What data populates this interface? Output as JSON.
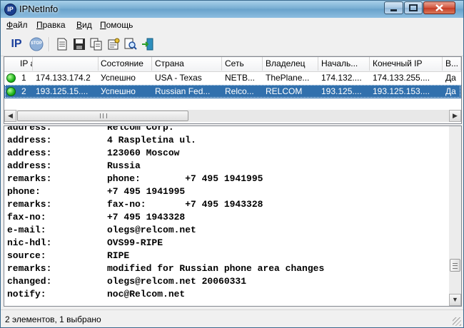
{
  "window": {
    "title": "IPNetInfo"
  },
  "menu": [
    {
      "label": "Файл",
      "accel": "Ф",
      "rest": "айл"
    },
    {
      "label": "Правка",
      "accel": "П",
      "rest": "равка"
    },
    {
      "label": "Вид",
      "accel": "В",
      "rest": "ид"
    },
    {
      "label": "Помощь",
      "accel": "П",
      "rest": "омощь"
    }
  ],
  "toolbar": {
    "ip_label": "IP",
    "stop_label": "STOP",
    "icons": [
      "ip-icon",
      "stop-icon",
      "document-icon",
      "save-icon",
      "copy-icon",
      "properties-icon",
      "find-icon",
      "exit-icon"
    ]
  },
  "list": {
    "columns": [
      "IP адрес",
      "Состояние",
      "Страна",
      "Сеть",
      "Владелец",
      "Началь...",
      "Конечный IP",
      "В..."
    ],
    "rows": [
      {
        "index": "1",
        "ip": "174.133.174.2",
        "status": "Успешно",
        "country": "USA - Texas",
        "network": "NETB...",
        "owner": "ThePlane...",
        "start": "174.132....",
        "end": "174.133.255....",
        "v": "Да",
        "selected": false
      },
      {
        "index": "2",
        "ip": "193.125.15....",
        "status": "Успешно",
        "country": "Russian Fed...",
        "network": "Relco...",
        "owner": "RELCOM",
        "start": "193.125....",
        "end": "193.125.153....",
        "v": "Да",
        "selected": true
      }
    ]
  },
  "whois": [
    {
      "key": "address:",
      "value": "Relcom Corp."
    },
    {
      "key": "address:",
      "value": "4 Raspletina ul."
    },
    {
      "key": "address:",
      "value": "123060 Moscow"
    },
    {
      "key": "address:",
      "value": "Russia"
    },
    {
      "key": "remarks:",
      "value": "phone:        +7 495 1941995"
    },
    {
      "key": "phone:",
      "value": "+7 495 1941995"
    },
    {
      "key": "remarks:",
      "value": "fax-no:       +7 495 1943328"
    },
    {
      "key": "fax-no:",
      "value": "+7 495 1943328"
    },
    {
      "key": "e-mail:",
      "value": "olegs@relcom.net"
    },
    {
      "key": "nic-hdl:",
      "value": "OVS99-RIPE"
    },
    {
      "key": "source:",
      "value": "RIPE"
    },
    {
      "key": "remarks:",
      "value": "modified for Russian phone area changes"
    },
    {
      "key": "changed:",
      "value": "olegs@relcom.net 20060331"
    },
    {
      "key": "notify:",
      "value": "noc@Relcom.net"
    }
  ],
  "status": {
    "text": "2 элементов, 1 выбрано"
  },
  "colors": {
    "selection": "#3170ad",
    "title_gradient": "#78aed2",
    "status_ok": "#1fb51c"
  }
}
